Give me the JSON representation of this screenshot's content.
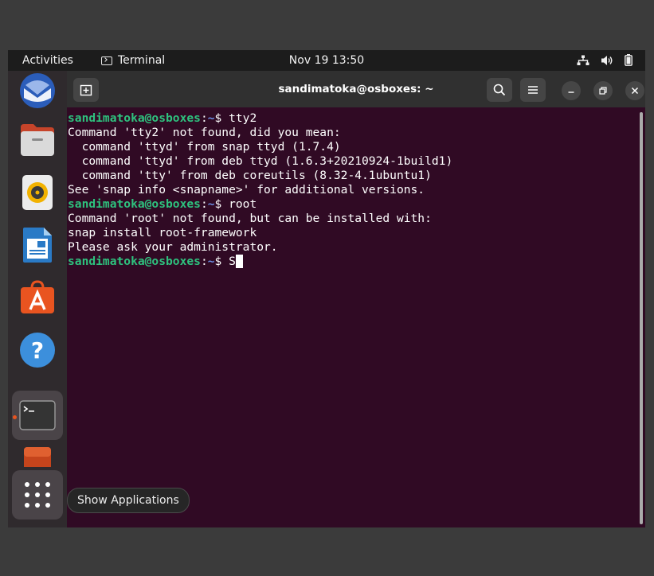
{
  "topbar": {
    "activities": "Activities",
    "app_name": "Terminal",
    "clock": "Nov 19  13:50",
    "tray_icons": [
      "network-icon",
      "volume-icon",
      "battery-icon"
    ]
  },
  "dock": {
    "items": [
      {
        "name": "thunderbird",
        "icon": "thunderbird-icon"
      },
      {
        "name": "files",
        "icon": "files-icon"
      },
      {
        "name": "rhythmbox",
        "icon": "rhythmbox-icon"
      },
      {
        "name": "libreoffice-writer",
        "icon": "writer-icon"
      },
      {
        "name": "software",
        "icon": "software-icon"
      },
      {
        "name": "help",
        "icon": "help-icon"
      },
      {
        "name": "terminal",
        "icon": "terminal-icon",
        "active": true
      },
      {
        "name": "extra-app",
        "icon": "extra-app-icon"
      },
      {
        "name": "show-applications",
        "icon": "app-grid-icon"
      }
    ],
    "tooltip": "Show Applications"
  },
  "window": {
    "title": "sandimatoka@osboxes: ~",
    "new_tab_icon": "new-tab-icon",
    "search_icon": "search-icon",
    "menu_icon": "hamburger-icon"
  },
  "terminal": {
    "prompt_user": "sandimatoka@osboxes",
    "prompt_path": "~",
    "lines": [
      {
        "type": "prompt",
        "cmd": "tty2"
      },
      {
        "type": "out",
        "text": "Command 'tty2' not found, did you mean:"
      },
      {
        "type": "out",
        "text": "  command 'ttyd' from snap ttyd (1.7.4)"
      },
      {
        "type": "out",
        "text": "  command 'ttyd' from deb ttyd (1.6.3+20210924-1build1)"
      },
      {
        "type": "out",
        "text": "  command 'tty' from deb coreutils (8.32-4.1ubuntu1)"
      },
      {
        "type": "out",
        "text": "See 'snap info <snapname>' for additional versions."
      },
      {
        "type": "prompt",
        "cmd": "root"
      },
      {
        "type": "out",
        "text": "Command 'root' not found, but can be installed with:"
      },
      {
        "type": "out",
        "text": "snap install root-framework"
      },
      {
        "type": "out",
        "text": "Please ask your administrator."
      },
      {
        "type": "prompt",
        "cmd": "S",
        "current": true
      }
    ]
  },
  "colors": {
    "terminal_bg": "#300a24",
    "prompt_user": "#2ec27e",
    "prompt_path": "#6b8ee6",
    "accent": "#e95420"
  }
}
